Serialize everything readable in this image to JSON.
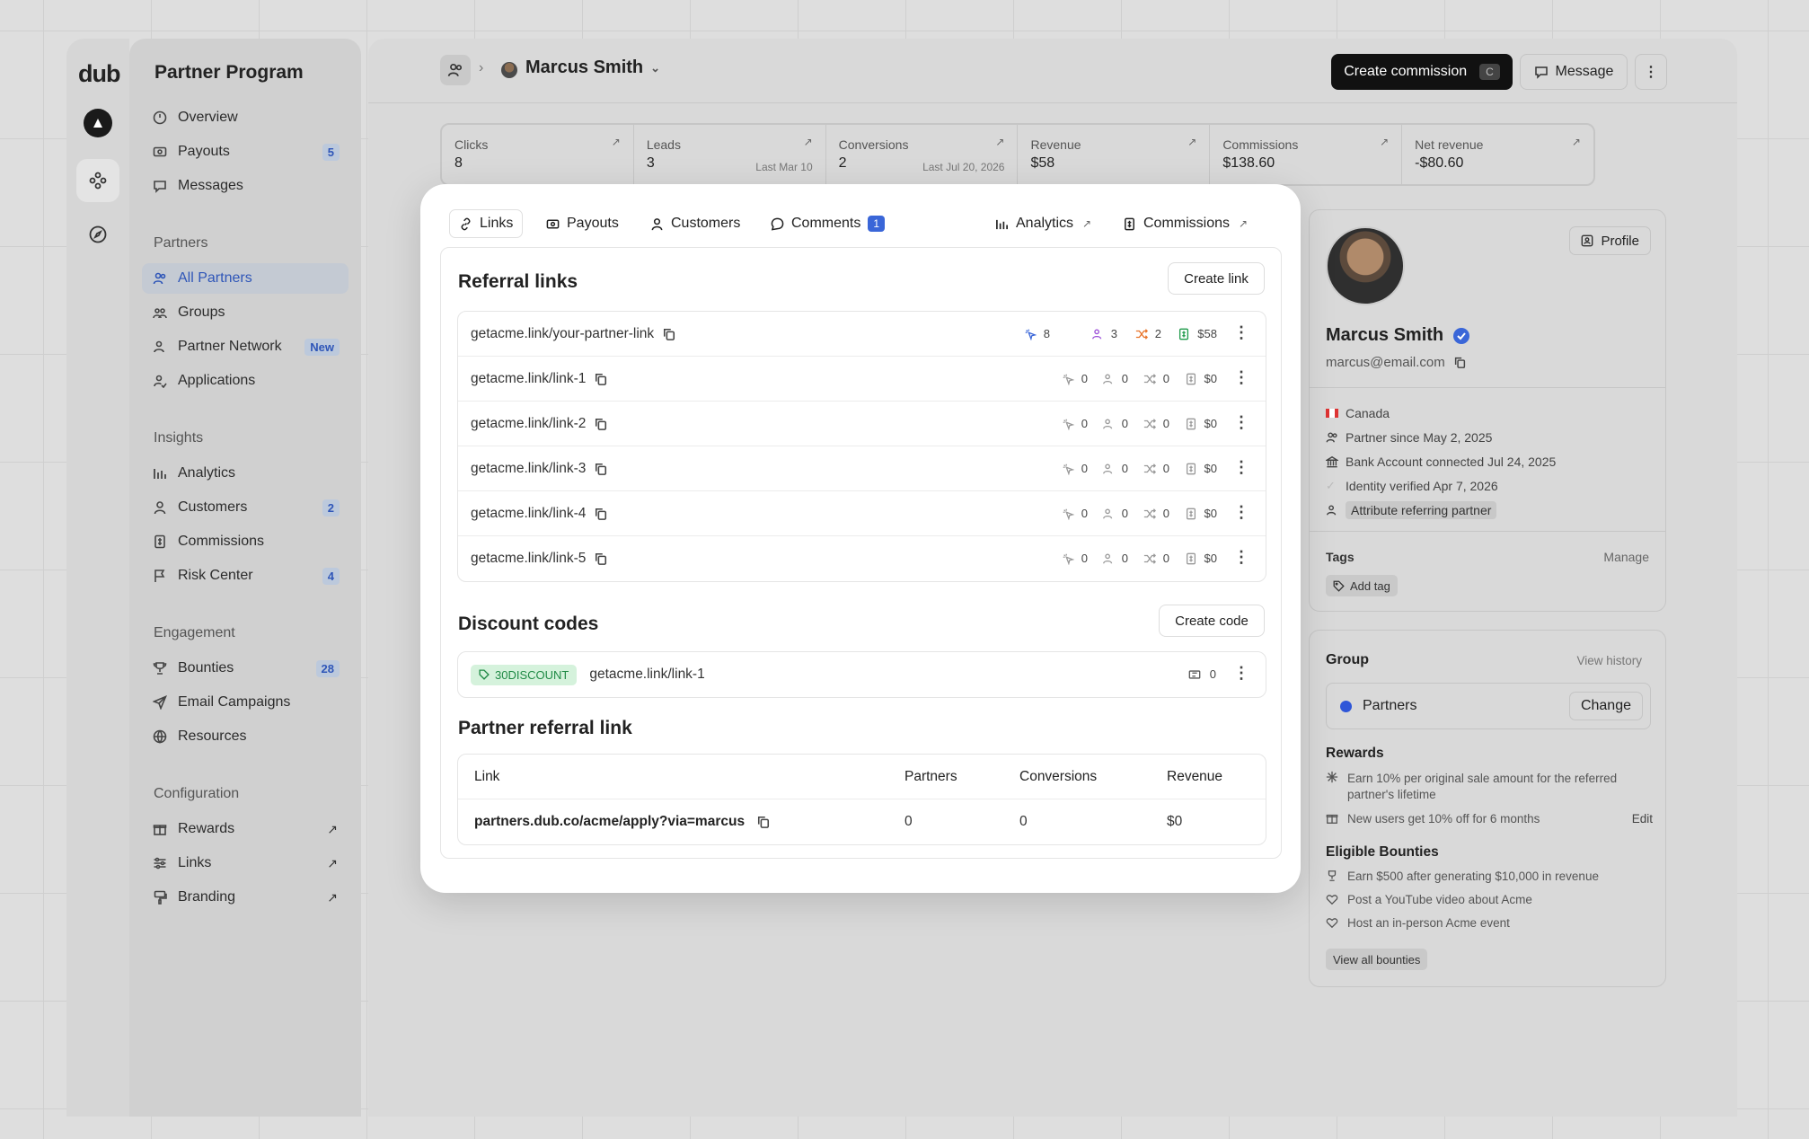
{
  "app": {
    "logo": "dub",
    "title": "Partner Program"
  },
  "sidebar": {
    "nav": [
      {
        "label": "Overview",
        "icon": "gauge-icon"
      },
      {
        "label": "Payouts",
        "icon": "money-icon",
        "badge": "5"
      },
      {
        "label": "Messages",
        "icon": "message-icon"
      }
    ],
    "partners_heading": "Partners",
    "partners": [
      {
        "label": "All Partners",
        "icon": "users-icon",
        "active": true
      },
      {
        "label": "Groups",
        "icon": "groups-icon"
      },
      {
        "label": "Partner Network",
        "icon": "user-plus-icon",
        "badge": "New"
      },
      {
        "label": "Applications",
        "icon": "user-check-icon"
      }
    ],
    "insights_heading": "Insights",
    "insights": [
      {
        "label": "Analytics",
        "icon": "chart-icon"
      },
      {
        "label": "Customers",
        "icon": "user-icon",
        "badge": "2"
      },
      {
        "label": "Commissions",
        "icon": "invoice-icon"
      },
      {
        "label": "Risk Center",
        "icon": "flag-icon",
        "badge": "4"
      }
    ],
    "engagement_heading": "Engagement",
    "engagement": [
      {
        "label": "Bounties",
        "icon": "trophy-icon",
        "badge": "28"
      },
      {
        "label": "Email Campaigns",
        "icon": "send-icon"
      },
      {
        "label": "Resources",
        "icon": "globe-icon"
      }
    ],
    "config_heading": "Configuration",
    "config": [
      {
        "label": "Rewards",
        "icon": "gift-icon"
      },
      {
        "label": "Links",
        "icon": "sliders-icon"
      },
      {
        "label": "Branding",
        "icon": "paint-icon"
      }
    ]
  },
  "header": {
    "partner_name": "Marcus Smith",
    "create_commission": "Create commission",
    "shortcut": "C",
    "message": "Message"
  },
  "stats": [
    {
      "label": "Clicks",
      "value": "8",
      "date": ""
    },
    {
      "label": "Leads",
      "value": "3",
      "date": "Last Mar 10"
    },
    {
      "label": "Conversions",
      "value": "2",
      "date": "Last Jul 20, 2026"
    },
    {
      "label": "Revenue",
      "value": "$58",
      "date": ""
    },
    {
      "label": "Commissions",
      "value": "$138.60",
      "date": ""
    },
    {
      "label": "Net revenue",
      "value": "-$80.60",
      "date": ""
    }
  ],
  "tabs": {
    "links": "Links",
    "payouts": "Payouts",
    "customers": "Customers",
    "comments": "Comments",
    "comments_count": "1",
    "analytics": "Analytics",
    "commissions": "Commissions"
  },
  "referral": {
    "title": "Referral links",
    "create": "Create link",
    "links": [
      {
        "url": "getacme.link/your-partner-link",
        "clicks": "8",
        "leads": "3",
        "sales": "2",
        "revenue": "$58",
        "active": true
      },
      {
        "url": "getacme.link/link-1",
        "clicks": "0",
        "leads": "0",
        "sales": "0",
        "revenue": "$0"
      },
      {
        "url": "getacme.link/link-2",
        "clicks": "0",
        "leads": "0",
        "sales": "0",
        "revenue": "$0"
      },
      {
        "url": "getacme.link/link-3",
        "clicks": "0",
        "leads": "0",
        "sales": "0",
        "revenue": "$0"
      },
      {
        "url": "getacme.link/link-4",
        "clicks": "0",
        "leads": "0",
        "sales": "0",
        "revenue": "$0"
      },
      {
        "url": "getacme.link/link-5",
        "clicks": "0",
        "leads": "0",
        "sales": "0",
        "revenue": "$0"
      }
    ]
  },
  "discount": {
    "title": "Discount codes",
    "create": "Create code",
    "code": "30DISCOUNT",
    "link": "getacme.link/link-1",
    "count": "0"
  },
  "partner_referral": {
    "title": "Partner referral link",
    "headers": {
      "link": "Link",
      "partners": "Partners",
      "conversions": "Conversions",
      "revenue": "Revenue"
    },
    "row": {
      "link": "partners.dub.co/acme/apply?via=marcus",
      "partners": "0",
      "conversions": "0",
      "revenue": "$0"
    }
  },
  "profile": {
    "button": "Profile",
    "name": "Marcus Smith",
    "email": "marcus@email.com",
    "country": "Canada",
    "since": "Partner since May 2, 2025",
    "bank": "Bank Account connected Jul 24, 2025",
    "identity": "Identity verified Apr 7, 2026",
    "attribute": "Attribute referring partner",
    "tags_label": "Tags",
    "manage": "Manage",
    "add_tag": "Add tag"
  },
  "group": {
    "title": "Group",
    "history": "View history",
    "name": "Partners",
    "change": "Change",
    "color": "#2f56d8",
    "rewards_title": "Rewards",
    "reward1": "Earn 10% per original sale amount for the referred partner's lifetime",
    "reward2": "New users get 10% off for 6 months",
    "edit": "Edit",
    "bounties_title": "Eligible Bounties",
    "bounties": [
      "Earn $500 after generating $10,000 in revenue",
      "Post a YouTube video about Acme",
      "Host an in-person Acme event"
    ],
    "view_all": "View all bounties"
  }
}
